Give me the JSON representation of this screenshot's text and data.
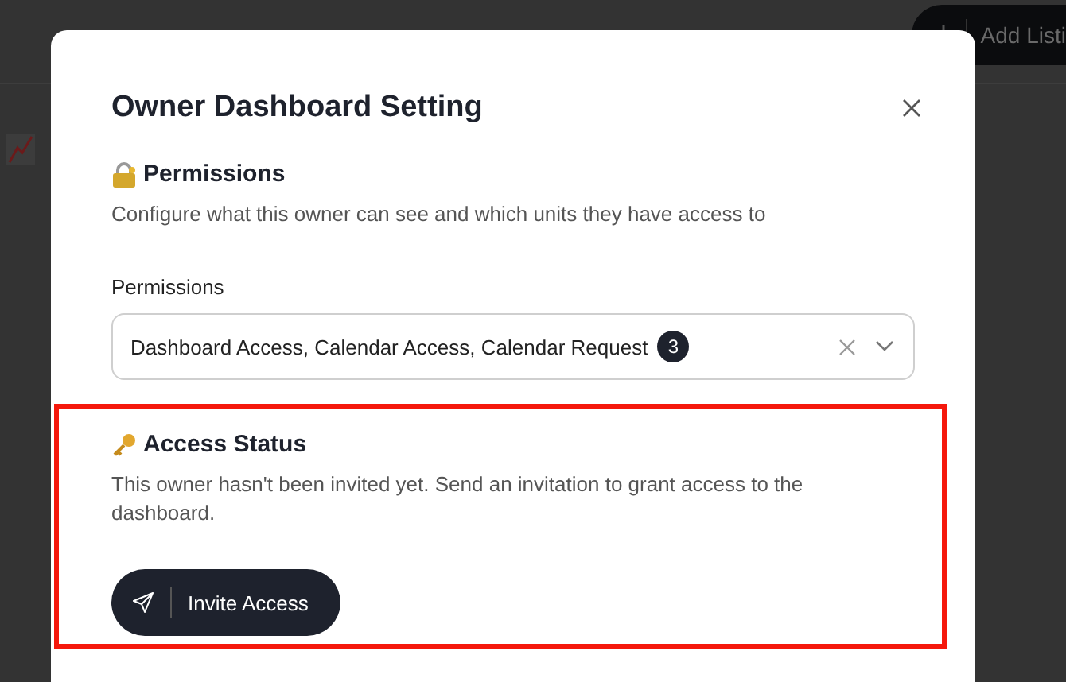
{
  "background": {
    "add_button": {
      "label": "Add Listi"
    }
  },
  "dialog": {
    "title": "Owner Dashboard Setting",
    "permissions": {
      "heading": "Permissions",
      "description": "Configure what this owner can see and which units they have access to",
      "field_label": "Permissions",
      "value": "Dashboard Access, Calendar Access, Calendar Request",
      "count": "3"
    },
    "access_status": {
      "heading": "Access Status",
      "description": "This owner hasn't been invited yet. Send an invitation to grant access to the dashboard.",
      "highlighted": true,
      "button": {
        "label": "Invite Access"
      }
    }
  }
}
